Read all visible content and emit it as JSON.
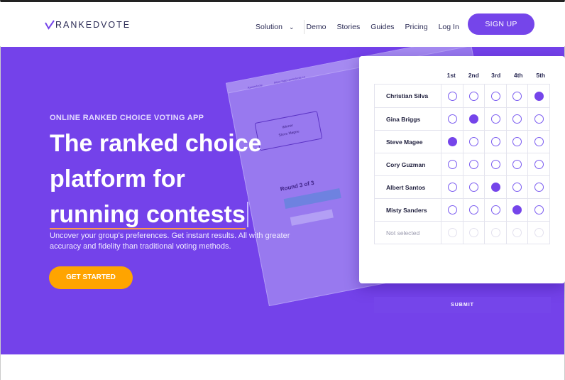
{
  "header": {
    "brand": "RANKEDVOTE",
    "nav": {
      "solution": "Solution",
      "demo": "Demo",
      "stories": "Stories",
      "guides": "Guides",
      "pricing": "Pricing",
      "login": "Log In"
    },
    "signup": "SIGN UP"
  },
  "hero": {
    "kicker": "ONLINE RANKED CHOICE VOTING APP",
    "headline_lead": "The ranked choice platform for",
    "headline_accent": "running contests",
    "subcopy": "Uncover your group's preferences. Get instant results. All with greater accuracy and fidelity than traditional voting methods.",
    "cta": "GET STARTED"
  },
  "mock": {
    "tab_title": "Rankedvote",
    "url": "https://app.rankedvote.co",
    "winner_label": "Winner",
    "winner_name": "Steve Magee",
    "round_label": "Round 3 of 3"
  },
  "ballot": {
    "columns": [
      "1st",
      "2nd",
      "3rd",
      "4th",
      "5th"
    ],
    "rows": [
      {
        "name": "Christian Silva",
        "selected": 5
      },
      {
        "name": "Gina Briggs",
        "selected": 2
      },
      {
        "name": "Steve Magee",
        "selected": 1
      },
      {
        "name": "Cory Guzman",
        "selected": 0
      },
      {
        "name": "Albert Santos",
        "selected": 3
      },
      {
        "name": "Misty Sanders",
        "selected": 4
      },
      {
        "name": "Not selected",
        "selected": 0,
        "muted": true
      }
    ],
    "submit": "SUBMIT"
  },
  "colors": {
    "brand_purple": "#7545ea",
    "hero_bg": "#7442ea",
    "cta_orange": "#ffa400",
    "underline_orange": "#ff9a4d"
  }
}
